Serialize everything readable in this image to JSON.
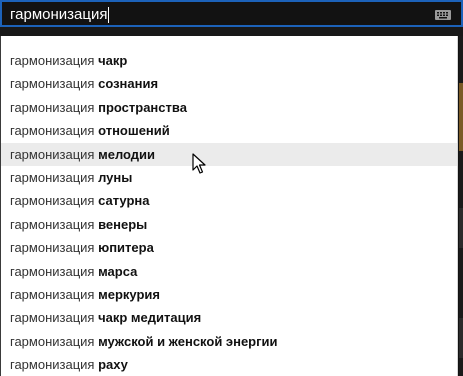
{
  "search": {
    "value": "гармонизация",
    "keyboard_icon": "keyboard-icon"
  },
  "colors": {
    "focus_border": "#1c62b9",
    "page_background": "#121212",
    "dropdown_background": "#ffffff",
    "hover_background": "#ebebeb"
  },
  "suggestions": [
    {
      "query": "гармонизация",
      "completion": "чакр"
    },
    {
      "query": "гармонизация",
      "completion": "сознания"
    },
    {
      "query": "гармонизация",
      "completion": "пространства"
    },
    {
      "query": "гармонизация",
      "completion": "отношений"
    },
    {
      "query": "гармонизация",
      "completion": "мелодии",
      "hovered": true
    },
    {
      "query": "гармонизация",
      "completion": "луны"
    },
    {
      "query": "гармонизация",
      "completion": "сатурна"
    },
    {
      "query": "гармонизация",
      "completion": "венеры"
    },
    {
      "query": "гармонизация",
      "completion": "юпитера"
    },
    {
      "query": "гармонизация",
      "completion": "марса"
    },
    {
      "query": "гармонизация",
      "completion": "меркурия"
    },
    {
      "query": "гармонизация",
      "completion": "чакр медитация"
    },
    {
      "query": "гармонизация",
      "completion": "мужской и женской энергии"
    },
    {
      "query": "гармонизация",
      "completion": "раху"
    }
  ],
  "pointer": {
    "icon": "mouse-pointer-icon"
  }
}
